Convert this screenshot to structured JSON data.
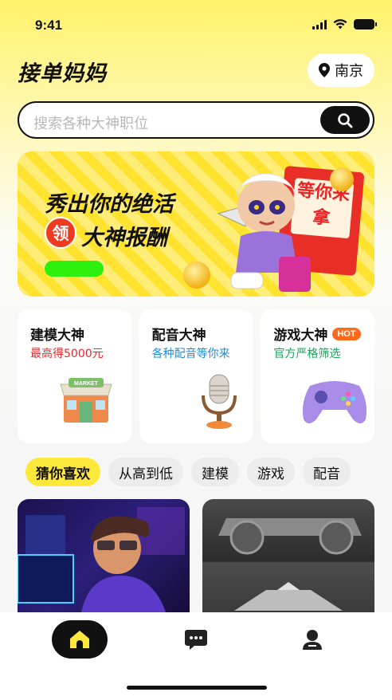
{
  "status_bar": {
    "time": "9:41"
  },
  "header": {
    "title": "接单妈妈",
    "city": "南京",
    "icon": "location-pin-icon"
  },
  "search": {
    "placeholder": "搜索各种大神职位",
    "icon": "search-icon"
  },
  "banner": {
    "line1": "秀出你的绝活",
    "badge": "领",
    "line2": "大神报酬",
    "sign": "等你来拿",
    "accent_colors": {
      "button": "#2df00e",
      "badge": "#ee3a20"
    }
  },
  "categories": [
    {
      "title": "建模大神",
      "subtitle": "最高得5000元",
      "subtitle_color": "#e8282b",
      "icon": "market-store-icon"
    },
    {
      "title": "配音大神",
      "subtitle": "各种配音等你来",
      "subtitle_color": "#1a8fe0",
      "icon": "microphone-icon"
    },
    {
      "title": "游戏大神",
      "badge": "HOT",
      "subtitle": "官方严格筛选",
      "subtitle_color": "#19a55a",
      "icon": "gamepad-icon"
    }
  ],
  "filters": [
    "猜你喜欢",
    "从高到低",
    "建模",
    "游戏",
    "配音"
  ],
  "active_filter": 0,
  "tabs": [
    {
      "name": "home",
      "icon": "home-icon",
      "active": true
    },
    {
      "name": "messages",
      "icon": "chat-bubble-icon",
      "active": false
    },
    {
      "name": "profile",
      "icon": "user-icon",
      "active": false
    }
  ],
  "theme": {
    "brand_yellow": "#ffe83c",
    "dark": "#111111"
  }
}
